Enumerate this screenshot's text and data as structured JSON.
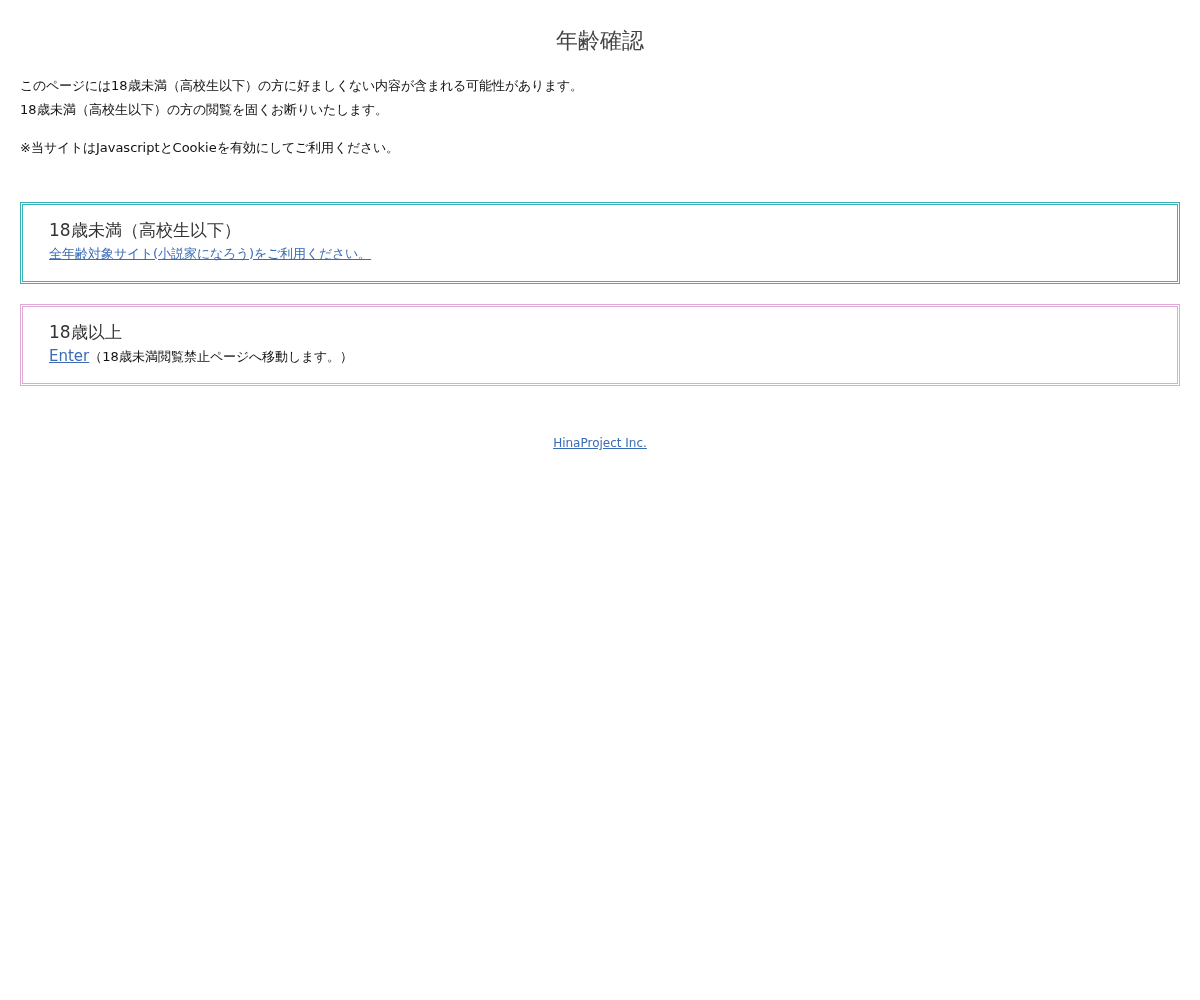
{
  "title": "年齢確認",
  "notice": [
    "このページには18歳未満（高校生以下）の方に好ましくない内容が含まれる可能性があります。",
    "18歳未満（高校生以下）の方の閲覧を固くお断りいたします。"
  ],
  "note": "※当サイトはJavascriptとCookieを有効にしてご利用ください。",
  "options": [
    {
      "heading": "18歳未満（高校生以下）",
      "link": "全年齢対象サイト(小説家になろう)をご利用ください。",
      "color": "#3ab0b8"
    },
    {
      "heading": "18歳以上",
      "link": "Enter",
      "description": "（18歳未満閲覧禁止ページへ移動します。）",
      "color": "#e0aad8"
    }
  ],
  "footer": {
    "link": "HinaProject Inc."
  }
}
